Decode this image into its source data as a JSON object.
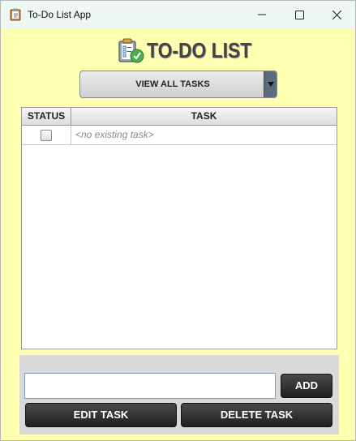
{
  "window": {
    "title": "To-Do List App",
    "controls": [
      "minimize-icon",
      "maximize-icon",
      "close-icon"
    ]
  },
  "header": {
    "title": "TO-DO LIST",
    "icon": "clipboard-check-icon"
  },
  "filter": {
    "selected": "VIEW ALL TASKS",
    "arrow_icon": "chevron-down-icon"
  },
  "table": {
    "columns": [
      "STATUS",
      "TASK"
    ],
    "rows": [
      {
        "checked": false,
        "task": "<no existing task>"
      }
    ]
  },
  "form": {
    "input_value": "",
    "add_label": "ADD",
    "edit_label": "EDIT TASK",
    "delete_label": "DELETE TASK"
  },
  "colors": {
    "background": "#ffffb2",
    "button_dark": "#2e2e2e",
    "panel": "#d9d9d9"
  }
}
